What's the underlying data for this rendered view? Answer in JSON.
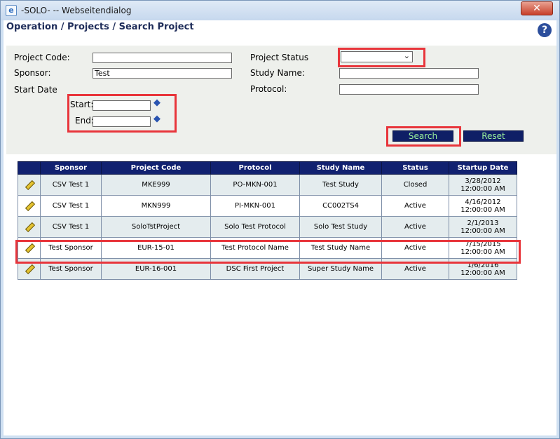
{
  "window": {
    "title": "-SOLO- -- Webseitendialog",
    "close_label": "✕"
  },
  "page": {
    "breadcrumb": "Operation / Projects / Search Project",
    "help_label": "?"
  },
  "form": {
    "project_code_label": "Project Code:",
    "project_code_value": "",
    "sponsor_label": "Sponsor:",
    "sponsor_value": "Test",
    "start_date_label": "Start Date",
    "start_label": "Start:",
    "start_value": "",
    "end_label": "End:",
    "end_value": "",
    "project_status_label": "Project Status",
    "project_status_value": "",
    "study_name_label": "Study Name:",
    "study_name_value": "",
    "protocol_label": "Protocol:",
    "protocol_value": "",
    "search_label": "Search",
    "reset_label": "Reset"
  },
  "table": {
    "headers": [
      "",
      "Sponsor",
      "Project Code",
      "Protocol",
      "Study Name",
      "Status",
      "Startup Date"
    ],
    "rows": [
      {
        "sponsor": "CSV Test 1",
        "project_code": "MKE999",
        "protocol": "PO-MKN-001",
        "study_name": "Test Study",
        "status": "Closed",
        "startup_date": "3/28/2012 12:00:00 AM"
      },
      {
        "sponsor": "CSV Test 1",
        "project_code": "MKN999",
        "protocol": "PI-MKN-001",
        "study_name": "CC002TS4",
        "status": "Active",
        "startup_date": "4/16/2012 12:00:00 AM"
      },
      {
        "sponsor": "CSV Test 1",
        "project_code": "SoloTstProject",
        "protocol": "Solo Test Protocol",
        "study_name": "Solo Test Study",
        "status": "Active",
        "startup_date": "2/1/2013 12:00:00 AM"
      },
      {
        "sponsor": "Test Sponsor",
        "project_code": "EUR-15-01",
        "protocol": "Test Protocol Name",
        "study_name": "Test Study Name",
        "status": "Active",
        "startup_date": "7/15/2015 12:00:00 AM"
      },
      {
        "sponsor": "Test Sponsor",
        "project_code": "EUR-16-001",
        "protocol": "DSC First Project",
        "study_name": "Super Study Name",
        "status": "Active",
        "startup_date": "1/6/2016 12:00:00 AM"
      }
    ]
  },
  "icons": {
    "edit": "pencil-icon",
    "calendar": "calendar-icon",
    "help": "help-icon",
    "app": "ie-icon"
  },
  "colors": {
    "header_bg": "#112170",
    "button_bg": "#0f1f66",
    "button_text": "#9cf29c",
    "highlight": "#e8353b",
    "title_text": "#1f2d5a"
  }
}
